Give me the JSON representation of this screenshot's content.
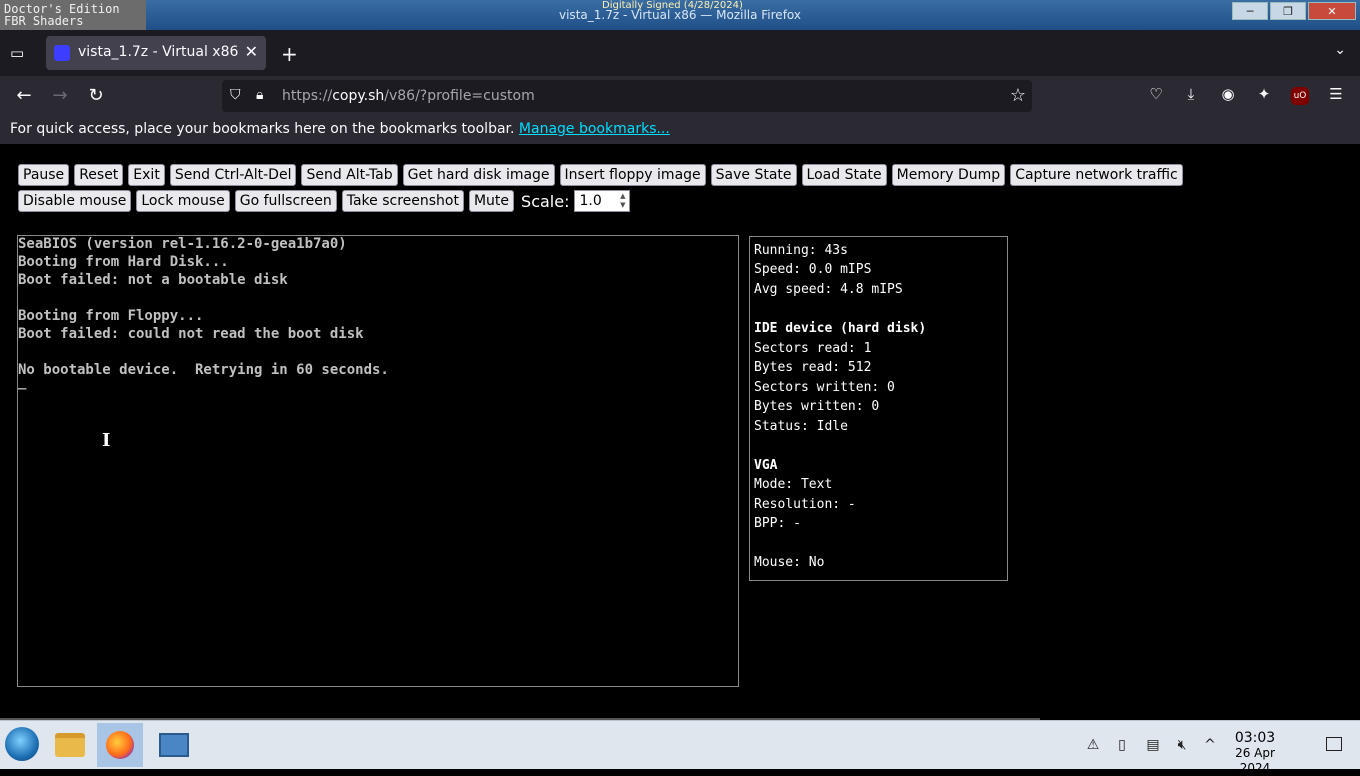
{
  "window": {
    "edition_label": "Doctor's Edition\nFBR Shaders",
    "title": "vista_1.7z - Virtual x86 — Mozilla Firefox",
    "signed": "Digitally Signed (4/28/2024)",
    "minimize": "─",
    "maximize": "❐",
    "close": "✕"
  },
  "tabs": [
    {
      "label": "vista_1.7z - Virtual x86",
      "close": "✕"
    }
  ],
  "tabstrip": {
    "new_tab": "+",
    "list_all": "⌄"
  },
  "nav": {
    "back": "←",
    "forward": "→",
    "reload": "↻",
    "url_prefix": "https://",
    "url_host": "copy.sh",
    "url_path": "/v86/?profile=custom",
    "star": "☆"
  },
  "bookmarks_bar": {
    "message": "For quick access, place your bookmarks here on the bookmarks toolbar.",
    "link": "Manage bookmarks..."
  },
  "controls": {
    "buttons": [
      "Pause",
      "Reset",
      "Exit",
      "Send Ctrl-Alt-Del",
      "Send Alt-Tab",
      "Get hard disk image",
      "Insert floppy image",
      "Save State",
      "Load State",
      "Memory Dump",
      "Capture network traffic",
      "Disable mouse",
      "Lock mouse",
      "Go fullscreen",
      "Take screenshot",
      "Mute"
    ],
    "scale_label": "Scale:",
    "scale_value": "1.0"
  },
  "screen_lines": [
    "SeaBIOS (version rel-1.16.2-0-gea1b7a0)",
    "Booting from Hard Disk...",
    "Boot failed: not a bootable disk",
    "",
    "Booting from Floppy...",
    "Boot failed: could not read the boot disk",
    "",
    "No bootable device.  Retrying in 60 seconds.",
    "_"
  ],
  "stats": {
    "running": "Running: 43s",
    "speed": "Speed: 0.0 mIPS",
    "avg_speed": "Avg speed: 4.8 mIPS",
    "ide_header": "IDE device (hard disk)",
    "sectors_read": "Sectors read: 1",
    "bytes_read": "Bytes read: 512",
    "sectors_written": "Sectors written: 0",
    "bytes_written": "Bytes written: 0",
    "status": "Status: Idle",
    "vga_header": "VGA",
    "mode": "Mode: Text",
    "resolution": "Resolution: -",
    "bpp": "BPP: -",
    "mouse": "Mouse: No"
  },
  "taskbar": {
    "time": "03:03",
    "date": "26 Apr 2024"
  }
}
